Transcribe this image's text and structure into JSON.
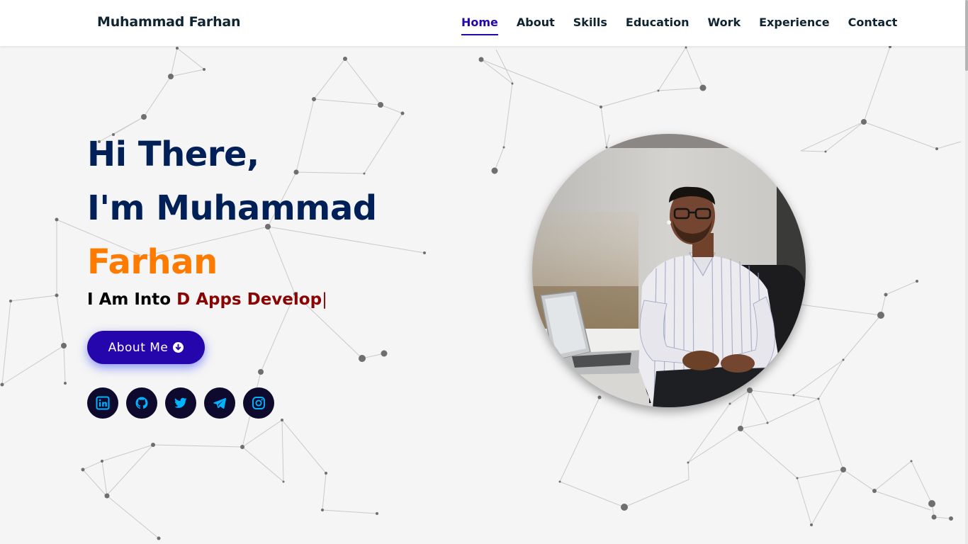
{
  "navbar": {
    "brand": "Muhammad Farhan",
    "links": [
      {
        "label": "Home",
        "active": true
      },
      {
        "label": "About",
        "active": false
      },
      {
        "label": "Skills",
        "active": false
      },
      {
        "label": "Education",
        "active": false
      },
      {
        "label": "Work",
        "active": false
      },
      {
        "label": "Experience",
        "active": false
      },
      {
        "label": "Contact",
        "active": false
      }
    ]
  },
  "hero": {
    "greeting": "Hi There,",
    "intro": "I'm Muhammad",
    "name_accent": "Farhan",
    "typed_prefix": "I Am Into",
    "typed_text": "D Apps Develop",
    "typed_cursor": "|",
    "about_button_label": "About Me",
    "about_button_icon": "arrow-circle-down-icon"
  },
  "socials": [
    {
      "name": "linkedin",
      "icon": "linkedin-icon"
    },
    {
      "name": "github",
      "icon": "github-icon"
    },
    {
      "name": "twitter",
      "icon": "twitter-icon"
    },
    {
      "name": "telegram",
      "icon": "telegram-icon"
    },
    {
      "name": "instagram",
      "icon": "instagram-icon"
    }
  ],
  "profile_image": {
    "icon": "profile-photo"
  },
  "colors": {
    "nav_text": "#0e2431",
    "nav_active": "#2506ad",
    "heading": "#002057",
    "name_accent": "#ff7b00",
    "typed_text": "#8a0303",
    "button_bg": "#2506ad",
    "social_bg": "#0e0a2e",
    "social_icon": "#00b3ff",
    "background": "#f5f5f5"
  }
}
